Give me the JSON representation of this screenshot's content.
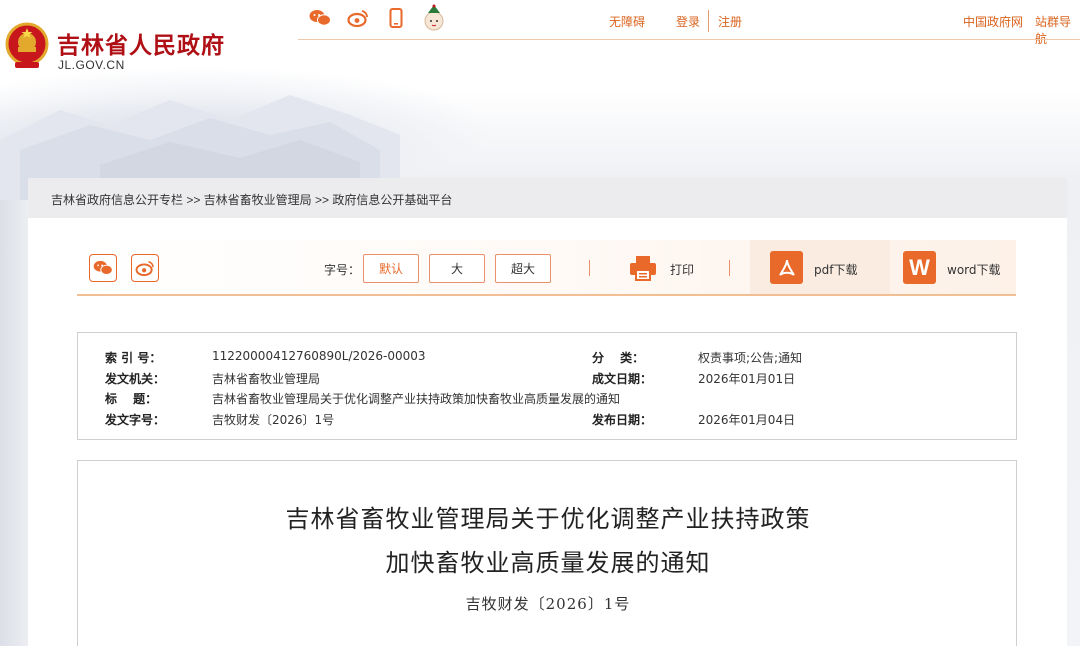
{
  "header": {
    "site_name": "吉林省人民政府",
    "site_domain": "JL.GOV.CN",
    "icons": [
      "wechat-icon",
      "weibo-icon",
      "mobile-icon",
      "mascot-icon"
    ],
    "links": {
      "accessible": "无障碍",
      "login": "登录",
      "register": "注册",
      "gov_portal": "中国政府网",
      "site_cluster": "站群导航"
    }
  },
  "breadcrumb": "吉林省政府信息公开专栏 >> 吉林省畜牧业管理局 >> 政府信息公开基础平台",
  "toolbar": {
    "font_label": "字号：",
    "font_default": "默认",
    "font_large": "大",
    "font_xlarge": "超大",
    "print": "打印",
    "pdf": "pdf下载",
    "word_icon": "W",
    "word": "word下载"
  },
  "meta": {
    "index_label": "索 引 号：",
    "index_value": "11220000412760890L/2026-00003",
    "category_label": "分　 类：",
    "category_value": "权责事项;公告;通知",
    "issuer_label": "发文机关：",
    "issuer_value": "吉林省畜牧业管理局",
    "created_label": "成文日期：",
    "created_value": "2026年01月01日",
    "title_label": "标　 题：",
    "title_value": "吉林省畜牧业管理局关于优化调整产业扶持政策加快畜牧业高质量发展的通知",
    "docno_label": "发文字号：",
    "docno_value": "吉牧财发〔2026〕1号",
    "published_label": "发布日期：",
    "published_value": "2026年01月04日"
  },
  "document": {
    "title_line1": "吉林省畜牧业管理局关于优化调整产业扶持政策",
    "title_line2": "加快畜牧业高质量发展的通知",
    "doc_number": "吉牧财发〔2026〕1号"
  },
  "colors": {
    "brand_red": "#b01015",
    "accent_orange": "#e8692a",
    "link_orange": "#d9631e"
  }
}
